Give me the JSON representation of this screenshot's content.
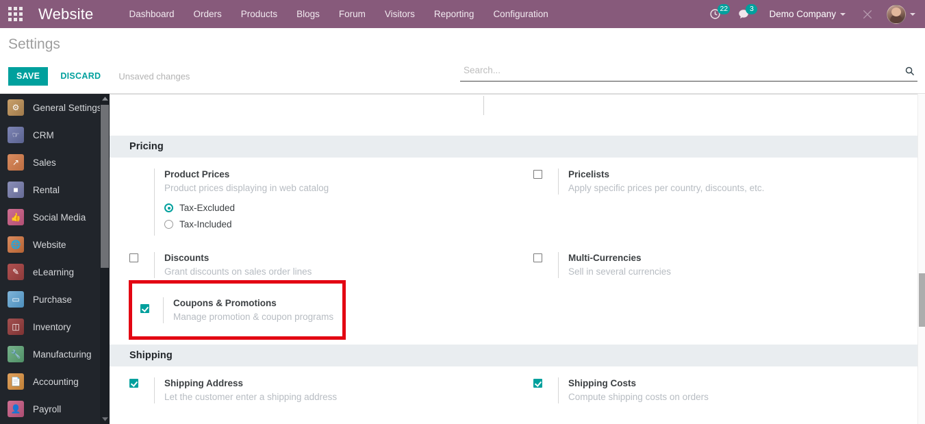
{
  "navbar": {
    "apps_icon": "apps-grid-icon",
    "brand": "Website",
    "menu": [
      {
        "label": "Dashboard"
      },
      {
        "label": "Orders"
      },
      {
        "label": "Products"
      },
      {
        "label": "Blogs"
      },
      {
        "label": "Forum"
      },
      {
        "label": "Visitors"
      },
      {
        "label": "Reporting"
      },
      {
        "label": "Configuration"
      }
    ],
    "activity": {
      "icon": "clock-icon",
      "count": "22"
    },
    "messages": {
      "icon": "chat-bubble-icon",
      "count": "3"
    },
    "company": "Demo Company",
    "debug_icon": "bug-debug-icon",
    "avatar_icon": "user-avatar"
  },
  "control_panel": {
    "title": "Settings",
    "save_label": "SAVE",
    "discard_label": "DISCARD",
    "unsaved_label": "Unsaved changes",
    "search_placeholder": "Search...",
    "search_value": "",
    "search_icon": "search-icon"
  },
  "sidebar": {
    "items": [
      {
        "label": "General Settings",
        "icon": "gear-icon",
        "cls": "ic-general",
        "glyph": "⚙"
      },
      {
        "label": "CRM",
        "icon": "handshake-icon",
        "cls": "ic-crm",
        "glyph": "✋"
      },
      {
        "label": "Sales",
        "icon": "chart-line-icon",
        "cls": "ic-sales",
        "glyph": "↗"
      },
      {
        "label": "Rental",
        "icon": "calendar-icon",
        "cls": "ic-rental",
        "glyph": "☰"
      },
      {
        "label": "Social Media",
        "icon": "thumbs-up-icon",
        "cls": "ic-social",
        "glyph": "👍"
      },
      {
        "label": "Website",
        "icon": "globe-icon",
        "cls": "ic-website",
        "glyph": "🌐"
      },
      {
        "label": "eLearning",
        "icon": "graduation-icon",
        "cls": "ic-elearn",
        "glyph": "✎"
      },
      {
        "label": "Purchase",
        "icon": "credit-card-icon",
        "cls": "ic-purchase",
        "glyph": "▭"
      },
      {
        "label": "Inventory",
        "icon": "box-icon",
        "cls": "ic-inventory",
        "glyph": "▤"
      },
      {
        "label": "Manufacturing",
        "icon": "wrench-icon",
        "cls": "ic-manufact",
        "glyph": "🔧"
      },
      {
        "label": "Accounting",
        "icon": "invoice-icon",
        "cls": "ic-accounting",
        "glyph": "📄"
      },
      {
        "label": "Payroll",
        "icon": "user-badge-icon",
        "cls": "ic-payroll",
        "glyph": "👤"
      }
    ],
    "scroll_up_icon": "chevron-up-icon",
    "scroll_down_icon": "chevron-down-icon"
  },
  "settings": {
    "sections": [
      {
        "name": "Pricing",
        "rows": [
          {
            "left": {
              "title": "Product Prices",
              "desc": "Product prices displaying in web catalog",
              "control": "none",
              "radios": [
                {
                  "label": "Tax-Excluded",
                  "selected": true
                },
                {
                  "label": "Tax-Included",
                  "selected": false
                }
              ]
            },
            "right": {
              "title": "Pricelists",
              "desc": "Apply specific prices per country, discounts, etc.",
              "control": "checkbox",
              "checked": false
            }
          },
          {
            "left": {
              "title": "Discounts",
              "desc": "Grant discounts on sales order lines",
              "control": "checkbox",
              "checked": false
            },
            "right": {
              "title": "Multi-Currencies",
              "desc": "Sell in several currencies",
              "control": "checkbox",
              "checked": false
            }
          },
          {
            "left": {
              "title": "Coupons & Promotions",
              "desc": "Manage promotion & coupon programs",
              "control": "checkbox",
              "checked": true,
              "highlighted": true
            },
            "right": null
          }
        ]
      },
      {
        "name": "Shipping",
        "rows": [
          {
            "left": {
              "title": "Shipping Address",
              "desc": "Let the customer enter a shipping address",
              "control": "checkbox",
              "checked": true
            },
            "right": {
              "title": "Shipping Costs",
              "desc": "Compute shipping costs on orders",
              "control": "checkbox",
              "checked": true
            }
          }
        ]
      }
    ]
  },
  "annotation": {
    "color": "#e30613",
    "target": "Coupons & Promotions"
  },
  "colors": {
    "brand_purple": "#875A7B",
    "accent_teal": "#00A09D",
    "sidebar_dark": "#21252b",
    "section_header_bg": "#e9edf0",
    "annotation_red": "#e30613"
  }
}
